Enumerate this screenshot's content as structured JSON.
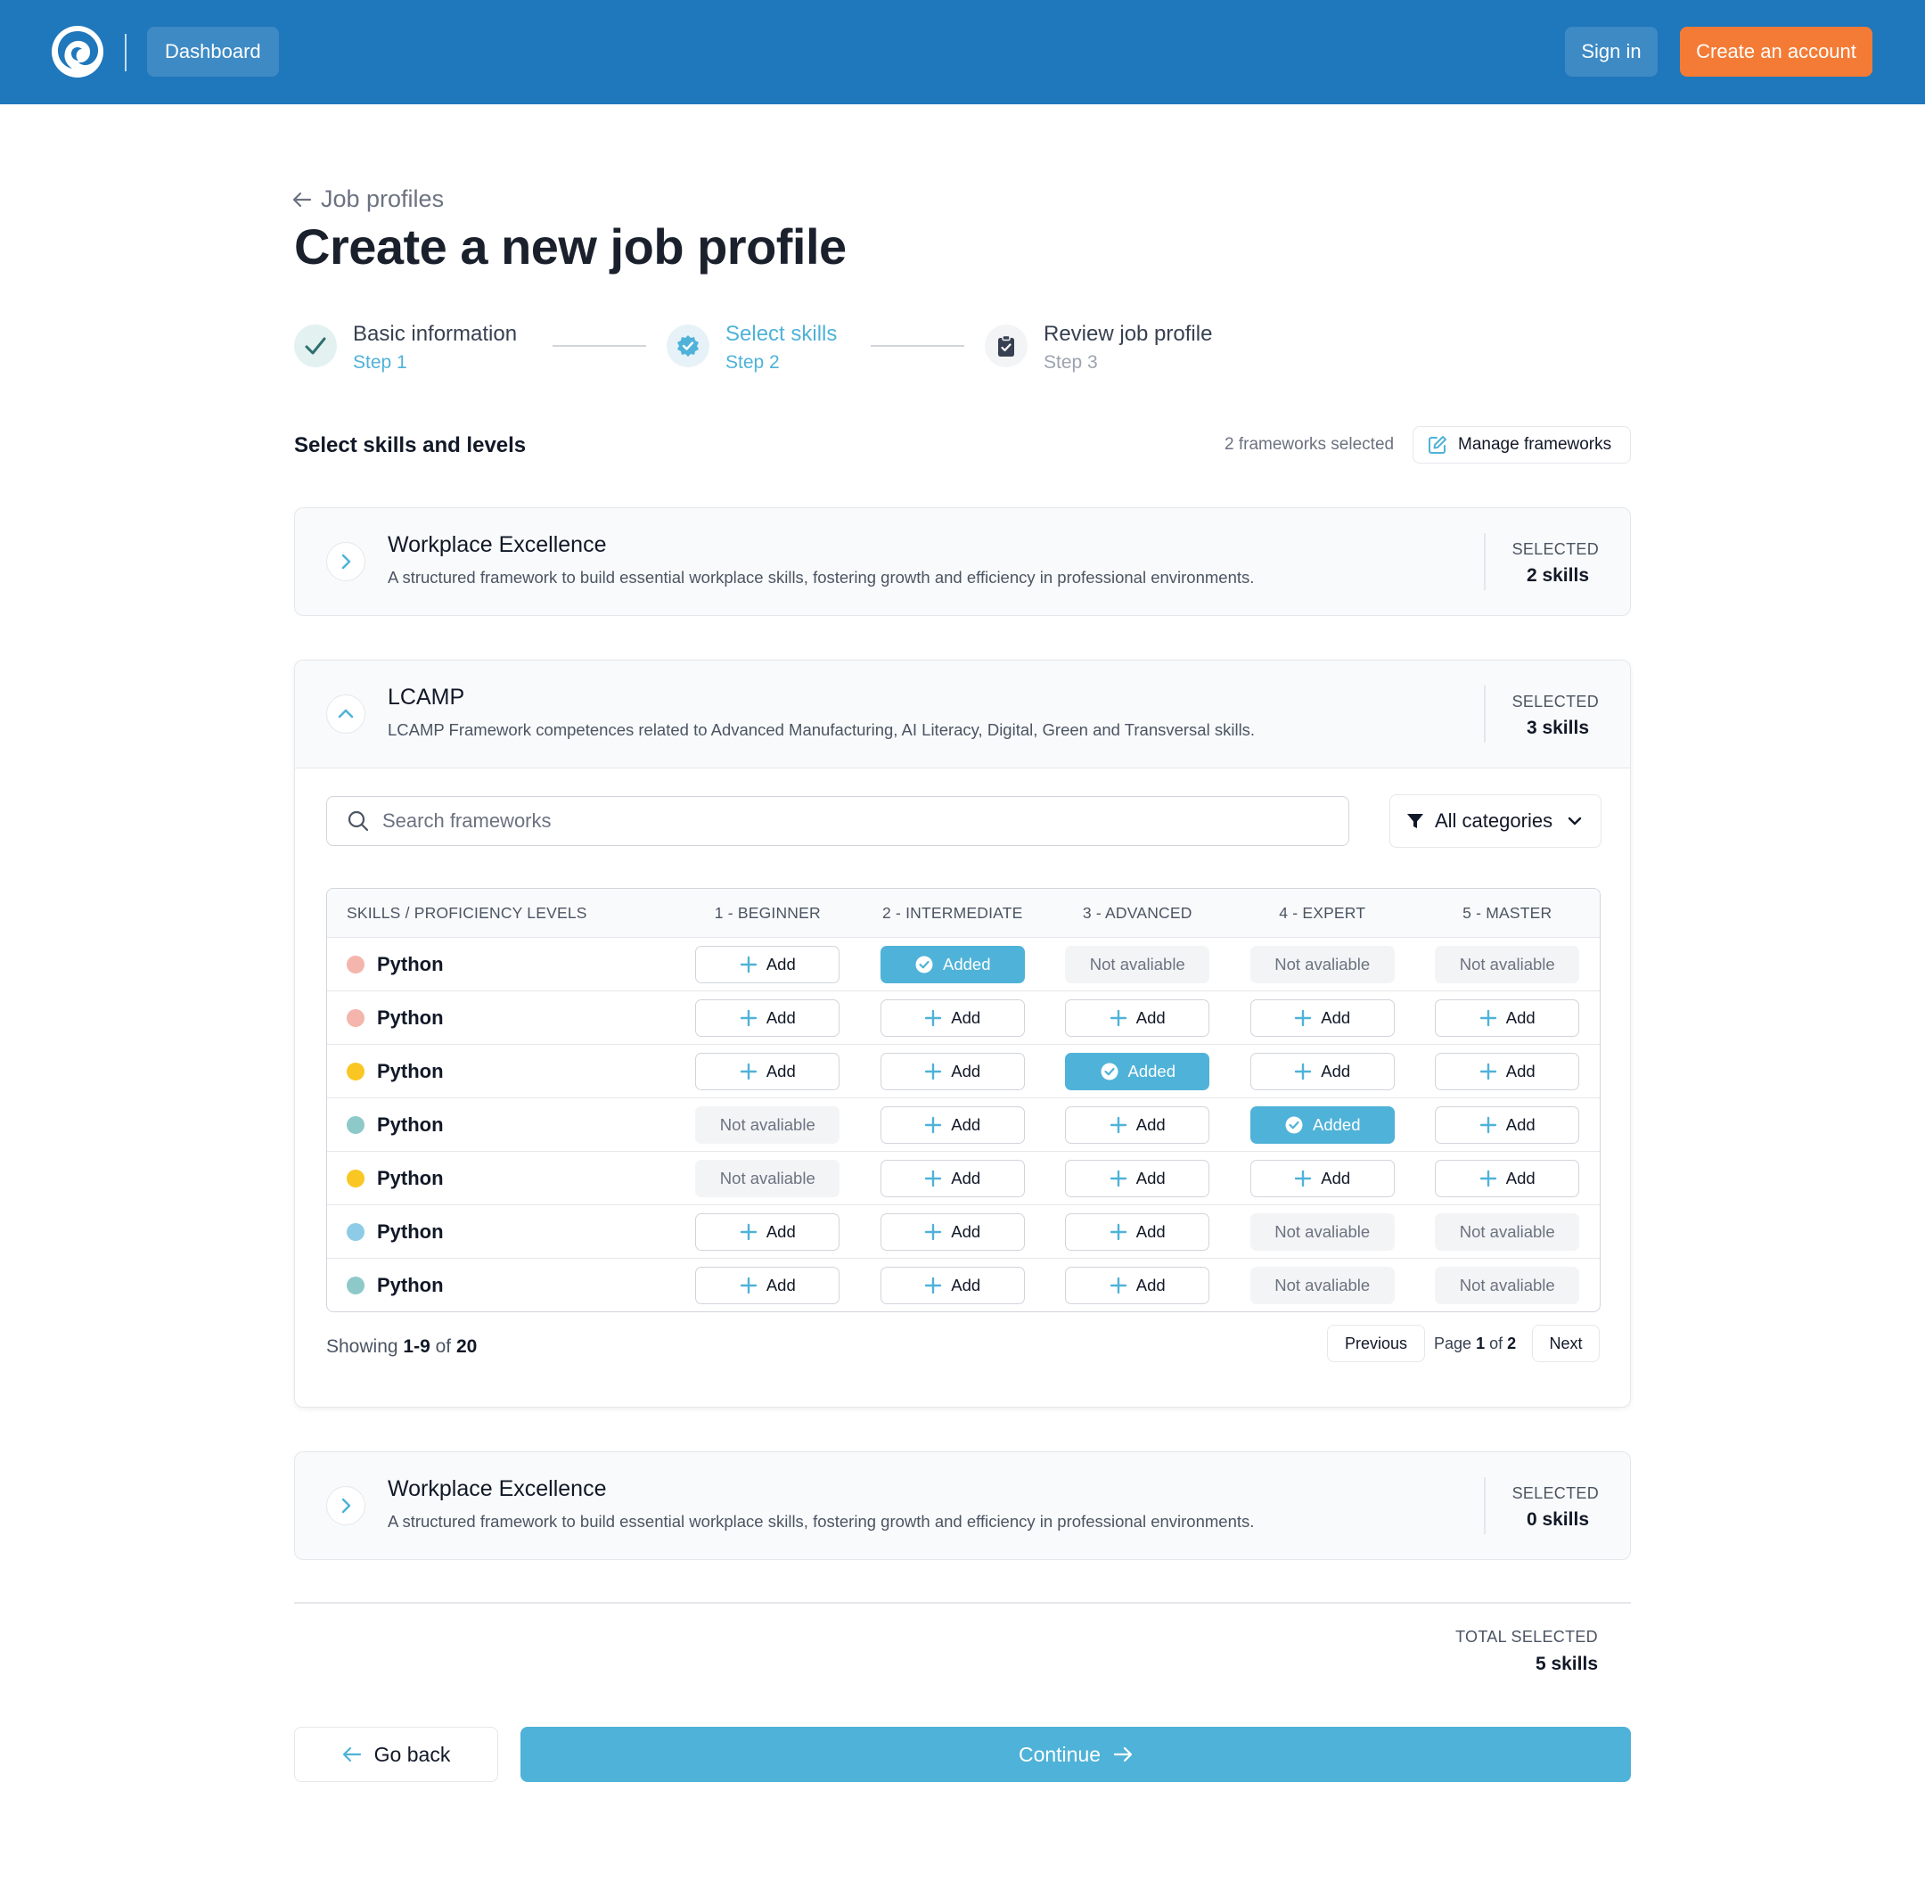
{
  "header": {
    "dashboard_label": "Dashboard",
    "signin_label": "Sign in",
    "create_account_label": "Create an account"
  },
  "breadcrumb": {
    "back_label": "Job profiles"
  },
  "page": {
    "title": "Create a new job profile"
  },
  "steps": [
    {
      "title": "Basic information",
      "sub": "Step 1",
      "state": "done"
    },
    {
      "title": "Select skills",
      "sub": "Step 2",
      "state": "current"
    },
    {
      "title": "Review job profile",
      "sub": "Step 3",
      "state": "upcoming"
    }
  ],
  "section": {
    "title": "Select skills and levels",
    "frameworks_selected": "2 frameworks selected",
    "manage_label": "Manage frameworks"
  },
  "frameworks": [
    {
      "name": "Workplace Excellence",
      "desc": "A structured framework to build essential workplace skills, fostering growth and efficiency in professional environments.",
      "selected_label": "SELECTED",
      "selected_value": "2 skills"
    },
    {
      "name": "LCAMP",
      "desc": "LCAMP Framework competences related to Advanced Manufacturing, AI Literacy, Digital, Green and Transversal skills.",
      "selected_label": "SELECTED",
      "selected_value": "3 skills"
    },
    {
      "name": "Workplace Excellence",
      "desc": "A structured framework to build essential workplace skills, fostering growth and efficiency in professional environments.",
      "selected_label": "SELECTED",
      "selected_value": "0 skills"
    }
  ],
  "search": {
    "placeholder": "Search frameworks"
  },
  "category_filter": {
    "label": "All categories"
  },
  "table": {
    "headers": [
      "SKILLS / PROFICIENCY LEVELS",
      "1 - BEGINNER",
      "2 - INTERMEDIATE",
      "3 - ADVANCED",
      "4 - EXPERT",
      "5 - MASTER"
    ],
    "labels": {
      "add": "Add",
      "added": "Added",
      "na": "Not avaliable"
    },
    "rows": [
      {
        "name": "Python",
        "color": "#f4b5ad",
        "levels": [
          "add",
          "added",
          "na",
          "na",
          "na"
        ]
      },
      {
        "name": "Python",
        "color": "#f4b5ad",
        "levels": [
          "add",
          "add",
          "add",
          "add",
          "add"
        ]
      },
      {
        "name": "Python",
        "color": "#f9c623",
        "levels": [
          "add",
          "add",
          "added",
          "add",
          "add"
        ]
      },
      {
        "name": "Python",
        "color": "#8ec9c9",
        "levels": [
          "na",
          "add",
          "add",
          "added",
          "add"
        ]
      },
      {
        "name": "Python",
        "color": "#f9c623",
        "levels": [
          "na",
          "add",
          "add",
          "add",
          "add"
        ]
      },
      {
        "name": "Python",
        "color": "#8dcbe6",
        "levels": [
          "add",
          "add",
          "add",
          "na",
          "na"
        ]
      },
      {
        "name": "Python",
        "color": "#8ec9c9",
        "levels": [
          "add",
          "add",
          "add",
          "na",
          "na"
        ]
      }
    ]
  },
  "pagination": {
    "showing_prefix": "Showing",
    "range": "1-9",
    "of_label": "of",
    "total": "20",
    "previous_label": "Previous",
    "page_label": "Page",
    "page_current": "1",
    "page_of": "of",
    "page_total": "2",
    "next_label": "Next"
  },
  "totals": {
    "label": "TOTAL SELECTED",
    "value": "5 skills"
  },
  "footer": {
    "back_label": "Go back",
    "continue_label": "Continue"
  },
  "colors": {
    "header": "#1f77bc",
    "accent": "#4fb2d8",
    "cta": "#f47b35"
  }
}
